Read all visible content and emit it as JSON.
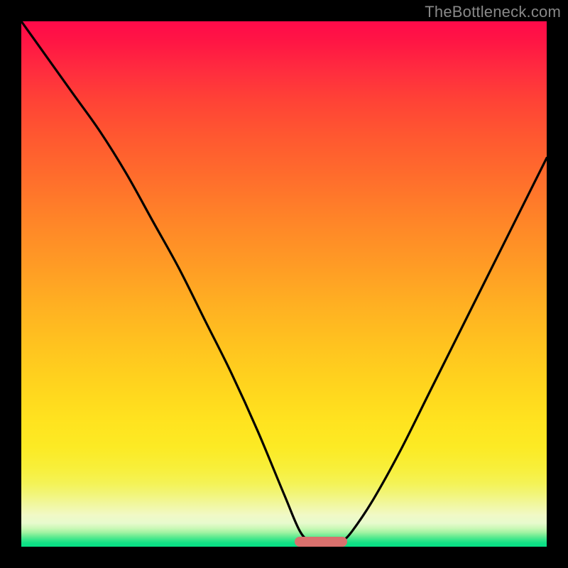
{
  "watermark": "TheBottleneck.com",
  "colors": {
    "frame": "#000000",
    "marker": "#d9706d",
    "curve": "#000000"
  },
  "chart_data": {
    "type": "line",
    "title": "",
    "xlabel": "",
    "ylabel": "",
    "xlim": [
      0,
      100
    ],
    "ylim": [
      0,
      100
    ],
    "grid": false,
    "legend": false,
    "note": "Bottleneck-style curve on a red-to-green vertical gradient; minimum ~x=57 at y≈0. Values are estimated from pixel positions.",
    "series": [
      {
        "name": "bottleneck-curve",
        "x": [
          0,
          5,
          10,
          15,
          20,
          25,
          30,
          35,
          40,
          45,
          50,
          53,
          55,
          57,
          59,
          61,
          63,
          67,
          72,
          78,
          85,
          92,
          100
        ],
        "y": [
          100,
          93,
          86,
          79,
          71,
          62,
          53,
          43,
          33,
          22,
          10,
          3,
          1,
          0,
          0,
          1,
          3,
          9,
          18,
          30,
          44,
          58,
          74
        ]
      }
    ],
    "marker": {
      "x_start": 52,
      "x_end": 62,
      "y": 0
    },
    "gradient_stops": [
      {
        "pos": 0.0,
        "color": "#ff0a4a"
      },
      {
        "pos": 0.3,
        "color": "#ff6e2c"
      },
      {
        "pos": 0.62,
        "color": "#ffc41f"
      },
      {
        "pos": 0.85,
        "color": "#f4f357"
      },
      {
        "pos": 0.96,
        "color": "#c9f8b6"
      },
      {
        "pos": 1.0,
        "color": "#06df85"
      }
    ]
  }
}
